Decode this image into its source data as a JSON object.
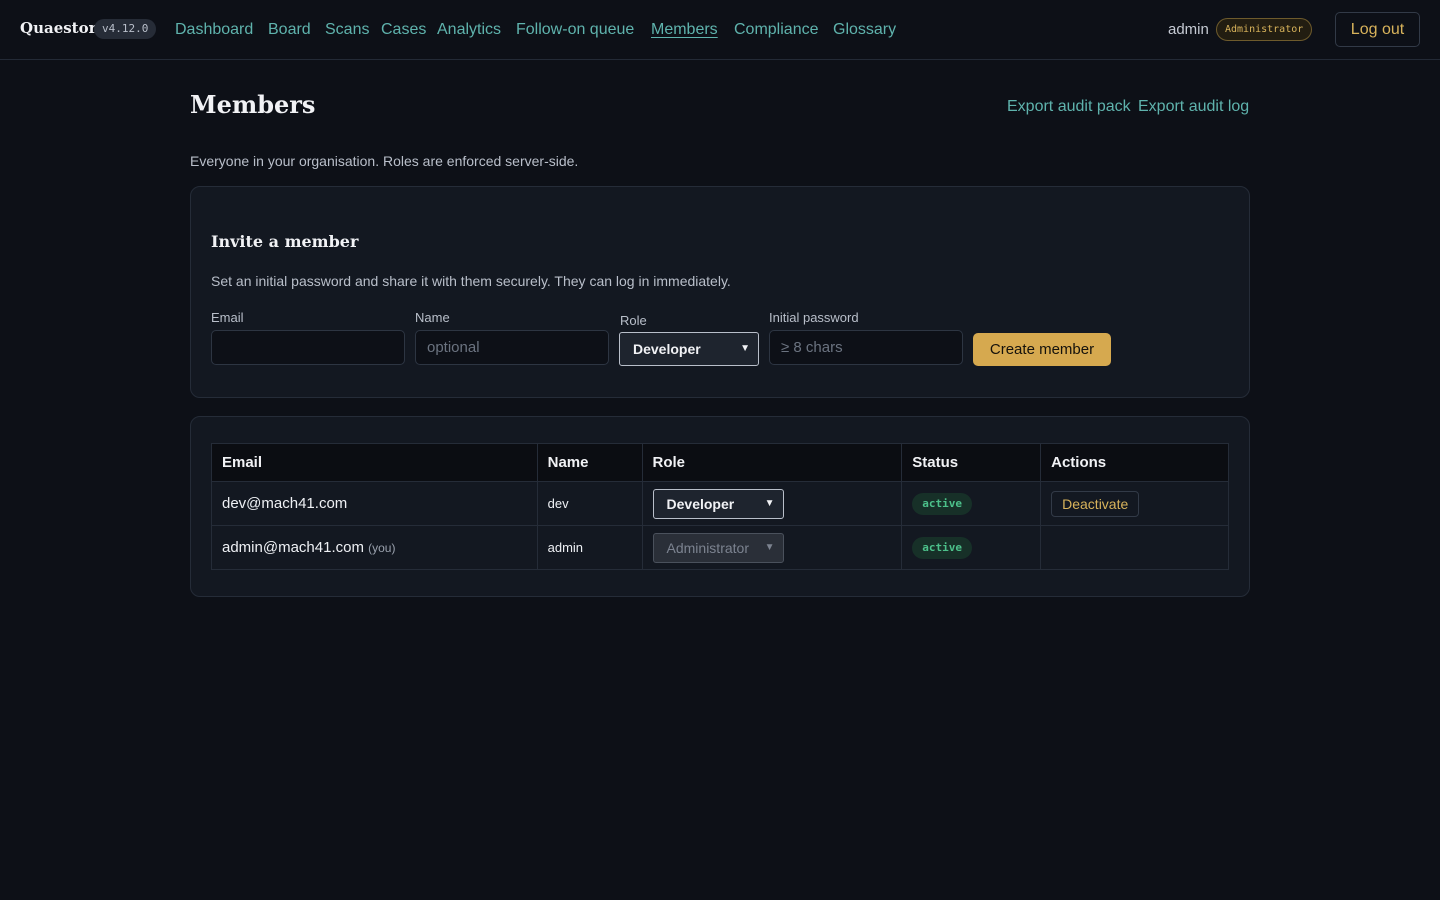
{
  "header": {
    "brand": "Quaestor",
    "version": "v4.12.0",
    "nav": [
      {
        "label": "Dashboard",
        "active": false
      },
      {
        "label": "Board",
        "active": false
      },
      {
        "label": "Scans",
        "active": false
      },
      {
        "label": "Cases",
        "active": false
      },
      {
        "label": "Analytics",
        "active": false
      },
      {
        "label": "Follow-on queue",
        "active": false
      },
      {
        "label": "Members",
        "active": true
      },
      {
        "label": "Compliance",
        "active": false
      },
      {
        "label": "Glossary",
        "active": false
      }
    ],
    "user": "admin",
    "role_badge": "Administrator",
    "logout_label": "Log out"
  },
  "page": {
    "title": "Members",
    "export_audit_pack": "Export audit pack",
    "export_audit_log": "Export audit log",
    "subtitle": "Everyone in your organisation. Roles are enforced server-side."
  },
  "invite": {
    "title": "Invite a member",
    "description": "Set an initial password and share it with them securely. They can log in immediately.",
    "email_label": "Email",
    "email_value": "",
    "email_placeholder": "",
    "name_label": "Name",
    "name_value": "",
    "name_placeholder": "optional",
    "role_label": "Role",
    "role_value": "Developer",
    "password_label": "Initial password",
    "password_value": "",
    "password_placeholder": "≥ 8 chars",
    "create_label": "Create member"
  },
  "members_table": {
    "columns": [
      "Email",
      "Name",
      "Role",
      "Status",
      "Actions"
    ],
    "rows": [
      {
        "email": "dev@mach41.com",
        "you": "",
        "name": "dev",
        "role": "Developer",
        "role_disabled": false,
        "status": "active",
        "action": "Deactivate"
      },
      {
        "email": "admin@mach41.com",
        "you": "(you)",
        "name": "admin",
        "role": "Administrator",
        "role_disabled": true,
        "status": "active",
        "action": ""
      }
    ]
  },
  "colors": {
    "background": "#0d1017",
    "card": "#131821",
    "link": "#5fb3ad",
    "accent_gold": "#d6a94f",
    "status_green": "#4cc08a"
  },
  "icons": {
    "select_chevron": "chevron-down-icon"
  }
}
